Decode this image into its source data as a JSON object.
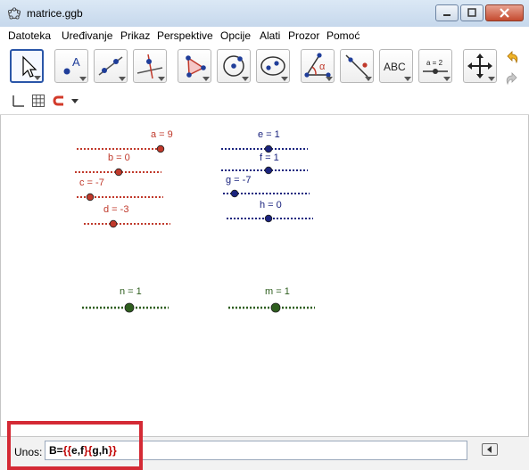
{
  "window": {
    "title": "matrice.ggb"
  },
  "menu": {
    "items": [
      "Datoteka",
      "Uređivanje",
      "Prikaz",
      "Perspektive",
      "Opcije",
      "Alati",
      "Prozor",
      "Pomoć"
    ]
  },
  "toolbar": {
    "tools": [
      {
        "icon": "move-arrow-icon",
        "selected": true
      },
      {
        "icon": "point-icon"
      },
      {
        "icon": "line-icon"
      },
      {
        "icon": "perpendicular-line-icon"
      },
      {
        "icon": "polygon-icon"
      },
      {
        "icon": "circle-icon"
      },
      {
        "icon": "ellipse-icon"
      },
      {
        "icon": "angle-icon",
        "glyph": "α"
      },
      {
        "icon": "reflect-line-icon"
      },
      {
        "icon": "text-icon",
        "glyph": "ABC"
      },
      {
        "icon": "slider-icon",
        "glyph": "a = 2"
      },
      {
        "icon": "move-graphics-view-icon"
      }
    ],
    "undo_icon": "undo-icon",
    "redo_icon": "redo-icon"
  },
  "stylebar": {
    "icons": [
      "axes-icon",
      "grid-icon",
      "point-capture-icon",
      "dropdown-arrow-icon"
    ]
  },
  "graphics": {
    "sliders": [
      {
        "id": "a",
        "label": "a = 9",
        "color": "#c0392b",
        "value": 9
      },
      {
        "id": "b",
        "label": "b = 0",
        "color": "#c0392b",
        "value": 0
      },
      {
        "id": "c",
        "label": "c = -7",
        "color": "#c0392b",
        "value": -7
      },
      {
        "id": "d",
        "label": "d = -3",
        "color": "#c0392b",
        "value": -3
      },
      {
        "id": "e",
        "label": "e = 1",
        "color": "#1a237e",
        "value": 1
      },
      {
        "id": "f",
        "label": "f = 1",
        "color": "#1a237e",
        "value": 1
      },
      {
        "id": "g",
        "label": "g = -7",
        "color": "#1a237e",
        "value": -7
      },
      {
        "id": "h",
        "label": "h = 0",
        "color": "#1a237e",
        "value": 0
      },
      {
        "id": "n",
        "label": "n = 1",
        "color": "#2e5e1e",
        "value": 1
      },
      {
        "id": "m",
        "label": "m = 1",
        "color": "#2e5e1e",
        "value": 1
      }
    ]
  },
  "input_bar": {
    "label": "Unos:",
    "value_parts": {
      "name": "B=",
      "open_outer": "{",
      "open1": "{",
      "v1": "e,f",
      "close1": "}",
      "open2": "{",
      "v2": "g,h",
      "close2": "}",
      "close_outer": "}"
    },
    "keyboard_icon": "virtual-keyboard-icon"
  },
  "colors": {
    "accent": "#2a56a8",
    "highlight": "#d42a35"
  }
}
